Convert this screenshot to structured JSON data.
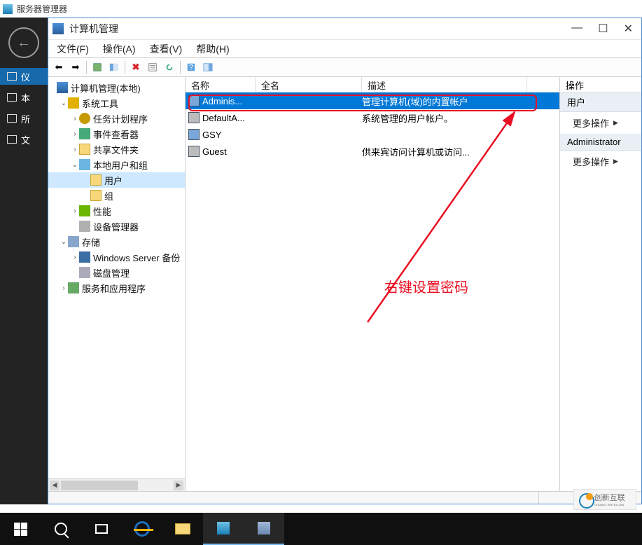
{
  "server_manager": {
    "title": "服务器管理器"
  },
  "left_stubs": [
    "仪",
    "本",
    "所",
    "文"
  ],
  "window": {
    "title": "计算机管理",
    "controls": {
      "min": "—",
      "max": "☐",
      "close": "✕"
    }
  },
  "menubar": [
    "文件(F)",
    "操作(A)",
    "查看(V)",
    "帮助(H)"
  ],
  "tree": {
    "root": "计算机管理(本地)",
    "nodes": [
      {
        "label": "系统工具",
        "expanded": true,
        "indent": 1,
        "icon": "ic-wrench",
        "children": [
          {
            "label": "任务计划程序",
            "indent": 2,
            "icon": "ic-clock",
            "expander": ">"
          },
          {
            "label": "事件查看器",
            "indent": 2,
            "icon": "ic-event",
            "expander": ">"
          },
          {
            "label": "共享文件夹",
            "indent": 2,
            "icon": "ic-folder",
            "expander": ">"
          },
          {
            "label": "本地用户和组",
            "indent": 2,
            "icon": "ic-users",
            "expanded": true,
            "children": [
              {
                "label": "用户",
                "indent": 3,
                "icon": "ic-folder",
                "selected": true
              },
              {
                "label": "组",
                "indent": 3,
                "icon": "ic-folder"
              }
            ]
          },
          {
            "label": "性能",
            "indent": 2,
            "icon": "ic-perf",
            "expander": ">"
          },
          {
            "label": "设备管理器",
            "indent": 2,
            "icon": "ic-dev"
          }
        ]
      },
      {
        "label": "存储",
        "expanded": true,
        "indent": 1,
        "icon": "ic-store",
        "children": [
          {
            "label": "Windows Server 备份",
            "indent": 2,
            "icon": "ic-win",
            "expander": ">"
          },
          {
            "label": "磁盘管理",
            "indent": 2,
            "icon": "ic-disk"
          }
        ]
      },
      {
        "label": "服务和应用程序",
        "indent": 1,
        "icon": "ic-gear",
        "expander": ">"
      }
    ]
  },
  "list": {
    "headers": {
      "name": "名称",
      "full": "全名",
      "desc": "描述"
    },
    "rows": [
      {
        "name": "Adminis...",
        "full": "",
        "desc": "管理计算机(域)的内置帐户",
        "selected": true,
        "state": "normal"
      },
      {
        "name": "DefaultA...",
        "full": "",
        "desc": "系统管理的用户帐户。",
        "state": "disabled"
      },
      {
        "name": "GSY",
        "full": "",
        "desc": "",
        "state": "normal"
      },
      {
        "name": "Guest",
        "full": "",
        "desc": "供来宾访问计算机或访问...",
        "state": "disabled"
      }
    ]
  },
  "annotation": "右键设置密码",
  "actions": {
    "header": "操作",
    "section1": "用户",
    "more1": "更多操作",
    "section2": "Administrator",
    "more2": "更多操作"
  },
  "watermark": {
    "line1": "创新互联",
    "line2": "CHUANG XIN HU LIAN"
  }
}
